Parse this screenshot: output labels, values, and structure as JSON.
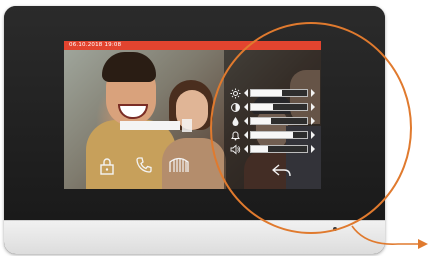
{
  "status_bar": {
    "datetime": "06.10.2018  19:08"
  },
  "settings": [
    {
      "name": "brightness",
      "icon": "brightness-icon",
      "level": 0.55
    },
    {
      "name": "contrast",
      "icon": "contrast-icon",
      "level": 0.4
    },
    {
      "name": "color",
      "icon": "color-icon",
      "level": 0.35
    },
    {
      "name": "ring-volume",
      "icon": "bell-icon",
      "level": 0.75
    },
    {
      "name": "talk-volume",
      "icon": "speaker-icon",
      "level": 0.3
    }
  ],
  "buttons": [
    {
      "name": "unlock-button",
      "icon": "lock-icon"
    },
    {
      "name": "call-button",
      "icon": "phone-icon"
    },
    {
      "name": "gate-button",
      "icon": "gate-icon"
    },
    {
      "name": "back-button",
      "icon": "back-icon"
    }
  ],
  "colors": {
    "status_bar": "#e2442f",
    "annotation": "#e07a2e"
  }
}
